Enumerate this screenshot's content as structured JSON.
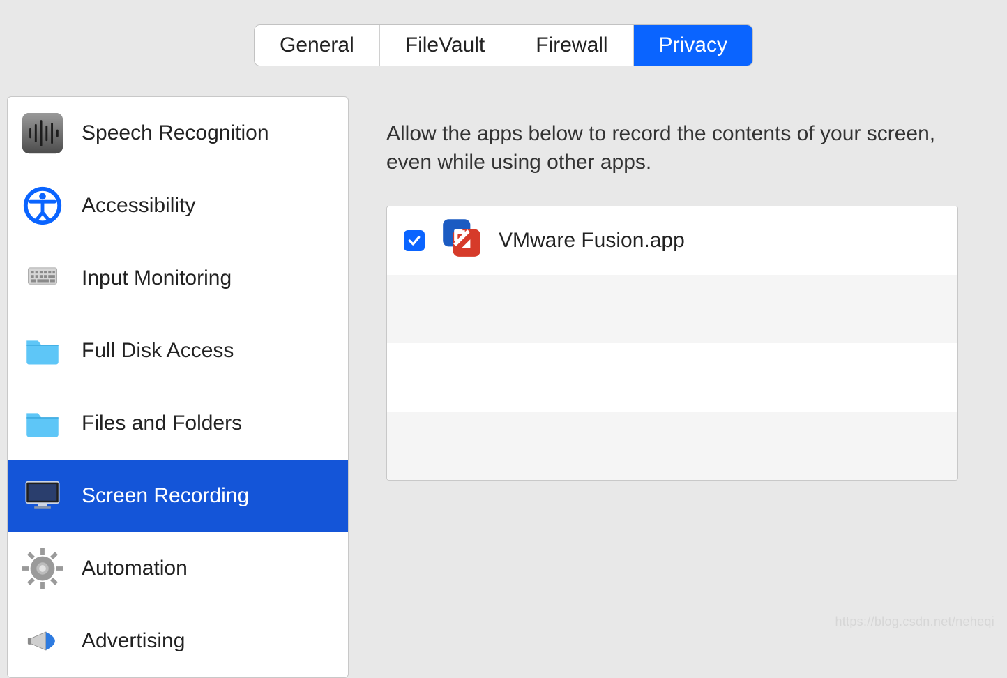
{
  "tabs": [
    {
      "label": "General",
      "active": false
    },
    {
      "label": "FileVault",
      "active": false
    },
    {
      "label": "Firewall",
      "active": false
    },
    {
      "label": "Privacy",
      "active": true
    }
  ],
  "sidebar": {
    "items": [
      {
        "label": "Speech Recognition",
        "icon": "waveform-icon",
        "active": false
      },
      {
        "label": "Accessibility",
        "icon": "accessibility-icon",
        "active": false
      },
      {
        "label": "Input Monitoring",
        "icon": "keyboard-icon",
        "active": false
      },
      {
        "label": "Full Disk Access",
        "icon": "folder-icon",
        "active": false
      },
      {
        "label": "Files and Folders",
        "icon": "folder-icon",
        "active": false
      },
      {
        "label": "Screen Recording",
        "icon": "monitor-icon",
        "active": true
      },
      {
        "label": "Automation",
        "icon": "gear-icon",
        "active": false
      },
      {
        "label": "Advertising",
        "icon": "megaphone-icon",
        "active": false
      }
    ]
  },
  "detail": {
    "description": "Allow the apps below to record the contents of your screen, even while using other apps.",
    "apps": [
      {
        "name": "VMware Fusion.app",
        "checked": true,
        "icon": "vmware-icon"
      }
    ]
  },
  "watermark": "https://blog.csdn.net/neheqi"
}
